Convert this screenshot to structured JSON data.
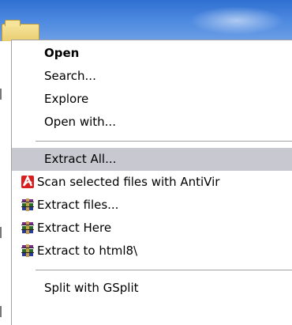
{
  "menu": {
    "open": "Open",
    "search": "Search...",
    "explore": "Explore",
    "open_with": "Open with...",
    "extract_all": "Extract All...",
    "scan": "Scan selected files with AntiVir",
    "extract_files": "Extract files...",
    "extract_here": "Extract Here",
    "extract_to": "Extract to html8\\",
    "split": "Split with GSplit"
  },
  "icons": {
    "antivir": "antivir-icon",
    "winrar": "winrar-icon"
  },
  "colors": {
    "highlight": "#c8c8d0",
    "antivir_red": "#d81e1e"
  }
}
